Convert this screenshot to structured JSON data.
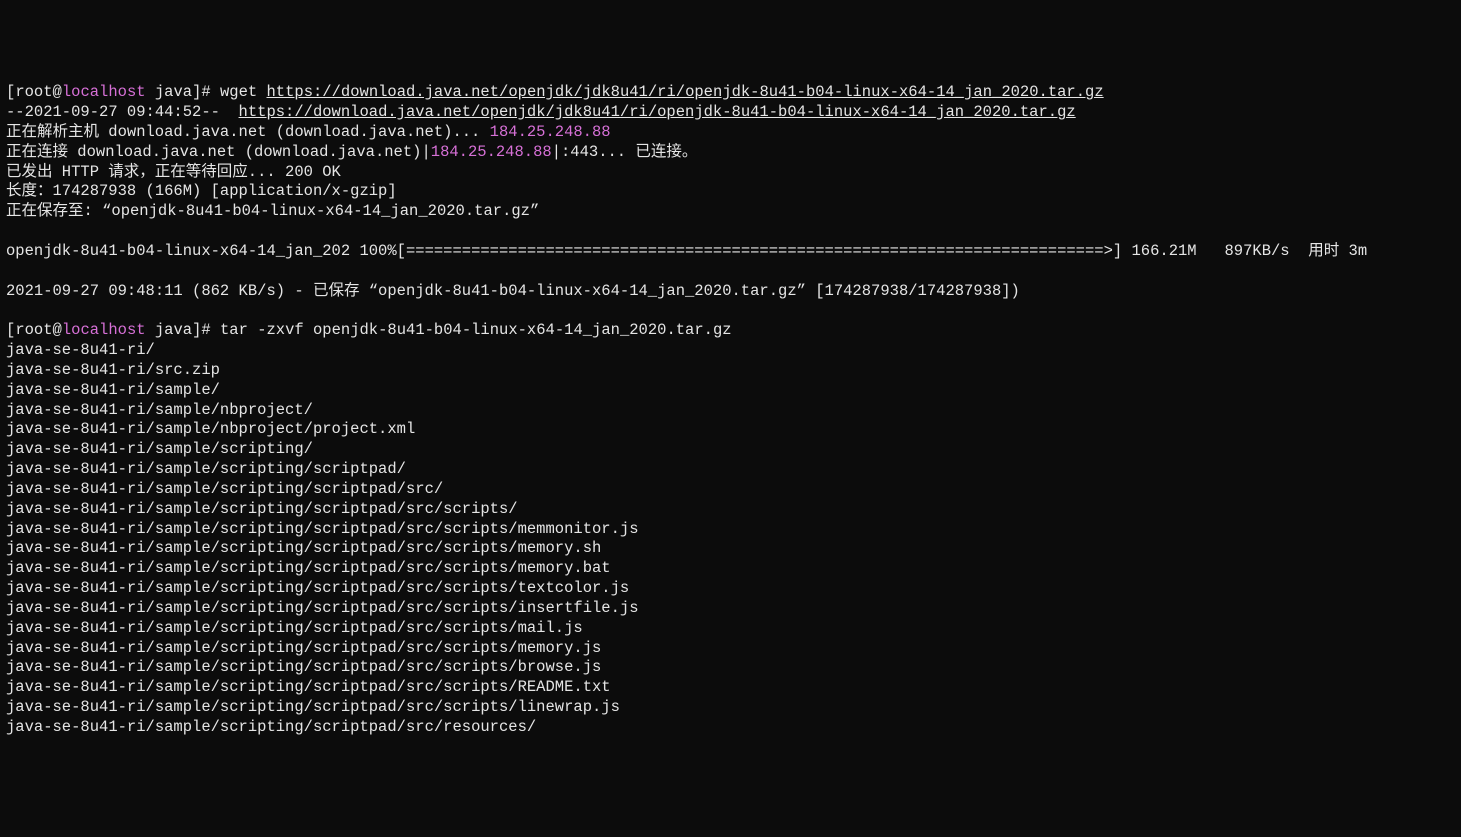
{
  "prompt1": {
    "open": "[",
    "user": "root",
    "at": "@",
    "host": "localhost",
    "dir": " java]# ",
    "cmd": "wget ",
    "url": "https://download.java.net/openjdk/jdk8u41/ri/openjdk-8u41-b04-linux-x64-14_jan_2020.tar.gz"
  },
  "wget": {
    "ts": "--2021-09-27 09:44:52--  ",
    "url": "https://download.java.net/openjdk/jdk8u41/ri/openjdk-8u41-b04-linux-x64-14_jan_2020.tar.gz",
    "resolve_pre": "正在解析主机 download.java.net (download.java.net)... ",
    "resolve_ip": "184.25.248.88",
    "connect_pre": "正在连接 download.java.net (download.java.net)|",
    "connect_ip": "184.25.248.88",
    "connect_post": "|:443... 已连接。",
    "http": "已发出 HTTP 请求，正在等待回应... 200 OK",
    "length": "长度：174287938 (166M) [application/x-gzip]",
    "saving": "正在保存至: “openjdk-8u41-b04-linux-x64-14_jan_2020.tar.gz”",
    "progress": "openjdk-8u41-b04-linux-x64-14_jan_202 100%[===========================================================================>] 166.21M   897KB/s  用时 3m",
    "done": "2021-09-27 09:48:11 (862 KB/s) - 已保存 “openjdk-8u41-b04-linux-x64-14_jan_2020.tar.gz” [174287938/174287938])"
  },
  "prompt2": {
    "open": "[",
    "user": "root",
    "at": "@",
    "host": "localhost",
    "dir": " java]# ",
    "cmd": "tar -zxvf openjdk-8u41-b04-linux-x64-14_jan_2020.tar.gz"
  },
  "tar": [
    "java-se-8u41-ri/",
    "java-se-8u41-ri/src.zip",
    "java-se-8u41-ri/sample/",
    "java-se-8u41-ri/sample/nbproject/",
    "java-se-8u41-ri/sample/nbproject/project.xml",
    "java-se-8u41-ri/sample/scripting/",
    "java-se-8u41-ri/sample/scripting/scriptpad/",
    "java-se-8u41-ri/sample/scripting/scriptpad/src/",
    "java-se-8u41-ri/sample/scripting/scriptpad/src/scripts/",
    "java-se-8u41-ri/sample/scripting/scriptpad/src/scripts/memmonitor.js",
    "java-se-8u41-ri/sample/scripting/scriptpad/src/scripts/memory.sh",
    "java-se-8u41-ri/sample/scripting/scriptpad/src/scripts/memory.bat",
    "java-se-8u41-ri/sample/scripting/scriptpad/src/scripts/textcolor.js",
    "java-se-8u41-ri/sample/scripting/scriptpad/src/scripts/insertfile.js",
    "java-se-8u41-ri/sample/scripting/scriptpad/src/scripts/mail.js",
    "java-se-8u41-ri/sample/scripting/scriptpad/src/scripts/memory.js",
    "java-se-8u41-ri/sample/scripting/scriptpad/src/scripts/browse.js",
    "java-se-8u41-ri/sample/scripting/scriptpad/src/scripts/README.txt",
    "java-se-8u41-ri/sample/scripting/scriptpad/src/scripts/linewrap.js",
    "java-se-8u41-ri/sample/scripting/scriptpad/src/resources/"
  ]
}
